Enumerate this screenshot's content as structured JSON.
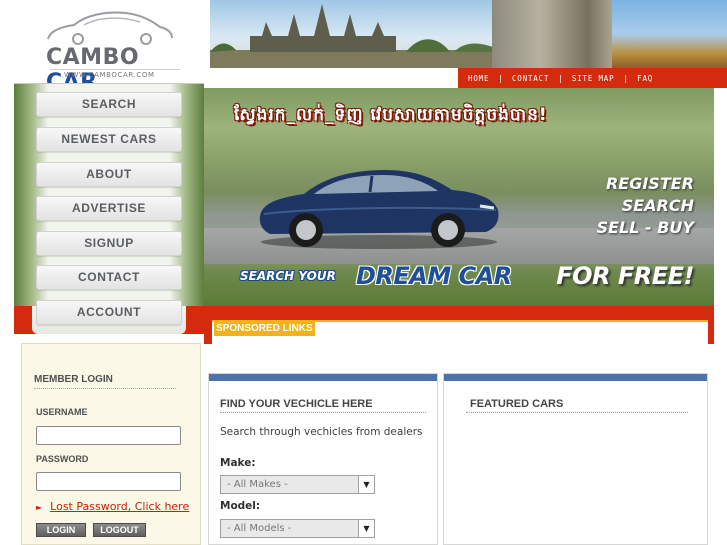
{
  "logo": {
    "word1": "CAMBO",
    "word2": "CAR",
    "url": "WWW.CAMBOCAR.COM"
  },
  "top_nav": [
    "HOME",
    "CONTACT",
    "SITE MAP",
    "FAQ"
  ],
  "left_menu": [
    "SEARCH",
    "NEWEST CARS",
    "ABOUT",
    "ADVERTISE",
    "SIGNUP",
    "CONTACT",
    "ACCOUNT"
  ],
  "hero": {
    "headline": "ស្វែងរក_លក់_ទិញ វេបសាយតាមចិត្តចង់បាន!",
    "taglines": [
      "REGISTER",
      "SEARCH",
      "SELL - BUY"
    ],
    "search_your": "SEARCH YOUR",
    "dream_car": "DREAM CAR",
    "for_free": "FOR FREE!"
  },
  "sponsored": {
    "label": "SPONSORED LINKS"
  },
  "login": {
    "title": "MEMBER LOGIN",
    "username_label": "USERNAME",
    "password_label": "PASSWORD",
    "lost_password": "Lost Password, Click here",
    "login_btn": "LOGIN",
    "logout_btn": "LOGOUT"
  },
  "find_vehicle": {
    "title": "FIND YOUR VECHICLE HERE",
    "intro": "Search through vechicles from dealers",
    "make_label": "Make:",
    "make_value": "- All Makes -",
    "model_label": "Model:",
    "model_value": "- All Models -"
  },
  "featured": {
    "title": "FEATURED CARS"
  },
  "colors": {
    "accent_red": "#d42a0e",
    "brand_blue": "#1d4e9c",
    "sponsored_yellow": "#f2b21b",
    "panel_blue": "#4d72ad"
  }
}
